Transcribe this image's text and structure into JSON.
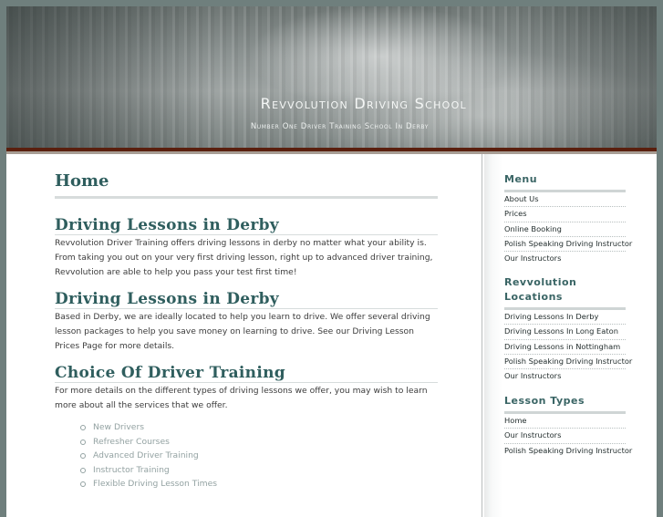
{
  "header": {
    "site_title": "Revvolution Driving School",
    "tagline": "Number One Driver Training School In Derby"
  },
  "main": {
    "page_title": "Home",
    "sections": [
      {
        "heading": "Driving Lessons in Derby",
        "text": "Revvolution Driver Training offers driving lessons in derby no matter what your ability is. From taking you out on your very first driving lesson, right up to advanced driver training, Revvolution are able to help you pass your test first time!"
      },
      {
        "heading": "Driving Lessons in Derby",
        "text": "Based in Derby, we are ideally located to help you learn to drive. We offer several driving lesson packages to help you save money on learning to drive. See our Driving Lesson Prices Page for more details."
      },
      {
        "heading": "Choice Of Driver Training",
        "text": "For more details on the different types of driving lessons we offer, you may wish to learn more about all the services that we offer.",
        "list": [
          "New Drivers",
          "Refresher Courses",
          "Advanced Driver Training",
          "Instructor Training",
          "Flexible Driving Lesson Times"
        ]
      }
    ]
  },
  "sidebar": {
    "menu": {
      "heading": "Menu",
      "items": [
        "About Us",
        "Prices",
        "Online Booking",
        "Polish Speaking Driving Instructor",
        "Our Instructors"
      ]
    },
    "locations": {
      "heading": "Revvolution Locations",
      "items": [
        "Driving Lessons In Derby",
        "Driving Lessons In Long Eaton",
        "Driving Lessons in Nottingham",
        "Polish Speaking Driving Instructor",
        "Our Instructors"
      ]
    },
    "lesson_types": {
      "heading": "Lesson Types",
      "items": [
        "Home",
        "Our Instructors",
        "Polish Speaking Driving Instructor"
      ]
    }
  }
}
